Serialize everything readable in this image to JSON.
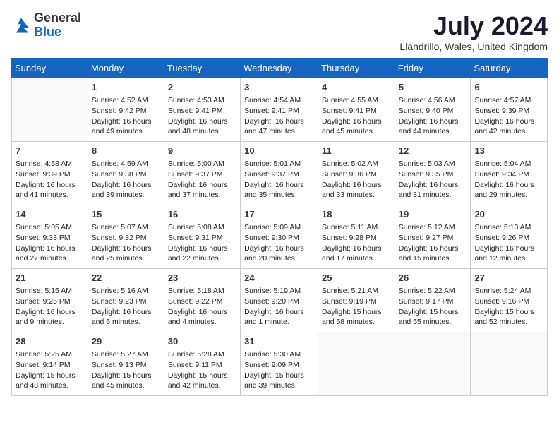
{
  "logo": {
    "general": "General",
    "blue": "Blue"
  },
  "title": "July 2024",
  "subtitle": "Llandrillo, Wales, United Kingdom",
  "days_of_week": [
    "Sunday",
    "Monday",
    "Tuesday",
    "Wednesday",
    "Thursday",
    "Friday",
    "Saturday"
  ],
  "weeks": [
    [
      {
        "day": "",
        "info": ""
      },
      {
        "day": "1",
        "info": "Sunrise: 4:52 AM\nSunset: 9:42 PM\nDaylight: 16 hours\nand 49 minutes."
      },
      {
        "day": "2",
        "info": "Sunrise: 4:53 AM\nSunset: 9:41 PM\nDaylight: 16 hours\nand 48 minutes."
      },
      {
        "day": "3",
        "info": "Sunrise: 4:54 AM\nSunset: 9:41 PM\nDaylight: 16 hours\nand 47 minutes."
      },
      {
        "day": "4",
        "info": "Sunrise: 4:55 AM\nSunset: 9:41 PM\nDaylight: 16 hours\nand 45 minutes."
      },
      {
        "day": "5",
        "info": "Sunrise: 4:56 AM\nSunset: 9:40 PM\nDaylight: 16 hours\nand 44 minutes."
      },
      {
        "day": "6",
        "info": "Sunrise: 4:57 AM\nSunset: 9:39 PM\nDaylight: 16 hours\nand 42 minutes."
      }
    ],
    [
      {
        "day": "7",
        "info": "Sunrise: 4:58 AM\nSunset: 9:39 PM\nDaylight: 16 hours\nand 41 minutes."
      },
      {
        "day": "8",
        "info": "Sunrise: 4:59 AM\nSunset: 9:38 PM\nDaylight: 16 hours\nand 39 minutes."
      },
      {
        "day": "9",
        "info": "Sunrise: 5:00 AM\nSunset: 9:37 PM\nDaylight: 16 hours\nand 37 minutes."
      },
      {
        "day": "10",
        "info": "Sunrise: 5:01 AM\nSunset: 9:37 PM\nDaylight: 16 hours\nand 35 minutes."
      },
      {
        "day": "11",
        "info": "Sunrise: 5:02 AM\nSunset: 9:36 PM\nDaylight: 16 hours\nand 33 minutes."
      },
      {
        "day": "12",
        "info": "Sunrise: 5:03 AM\nSunset: 9:35 PM\nDaylight: 16 hours\nand 31 minutes."
      },
      {
        "day": "13",
        "info": "Sunrise: 5:04 AM\nSunset: 9:34 PM\nDaylight: 16 hours\nand 29 minutes."
      }
    ],
    [
      {
        "day": "14",
        "info": "Sunrise: 5:05 AM\nSunset: 9:33 PM\nDaylight: 16 hours\nand 27 minutes."
      },
      {
        "day": "15",
        "info": "Sunrise: 5:07 AM\nSunset: 9:32 PM\nDaylight: 16 hours\nand 25 minutes."
      },
      {
        "day": "16",
        "info": "Sunrise: 5:08 AM\nSunset: 9:31 PM\nDaylight: 16 hours\nand 22 minutes."
      },
      {
        "day": "17",
        "info": "Sunrise: 5:09 AM\nSunset: 9:30 PM\nDaylight: 16 hours\nand 20 minutes."
      },
      {
        "day": "18",
        "info": "Sunrise: 5:11 AM\nSunset: 9:28 PM\nDaylight: 16 hours\nand 17 minutes."
      },
      {
        "day": "19",
        "info": "Sunrise: 5:12 AM\nSunset: 9:27 PM\nDaylight: 16 hours\nand 15 minutes."
      },
      {
        "day": "20",
        "info": "Sunrise: 5:13 AM\nSunset: 9:26 PM\nDaylight: 16 hours\nand 12 minutes."
      }
    ],
    [
      {
        "day": "21",
        "info": "Sunrise: 5:15 AM\nSunset: 9:25 PM\nDaylight: 16 hours\nand 9 minutes."
      },
      {
        "day": "22",
        "info": "Sunrise: 5:16 AM\nSunset: 9:23 PM\nDaylight: 16 hours\nand 6 minutes."
      },
      {
        "day": "23",
        "info": "Sunrise: 5:18 AM\nSunset: 9:22 PM\nDaylight: 16 hours\nand 4 minutes."
      },
      {
        "day": "24",
        "info": "Sunrise: 5:19 AM\nSunset: 9:20 PM\nDaylight: 16 hours\nand 1 minute."
      },
      {
        "day": "25",
        "info": "Sunrise: 5:21 AM\nSunset: 9:19 PM\nDaylight: 15 hours\nand 58 minutes."
      },
      {
        "day": "26",
        "info": "Sunrise: 5:22 AM\nSunset: 9:17 PM\nDaylight: 15 hours\nand 55 minutes."
      },
      {
        "day": "27",
        "info": "Sunrise: 5:24 AM\nSunset: 9:16 PM\nDaylight: 15 hours\nand 52 minutes."
      }
    ],
    [
      {
        "day": "28",
        "info": "Sunrise: 5:25 AM\nSunset: 9:14 PM\nDaylight: 15 hours\nand 48 minutes."
      },
      {
        "day": "29",
        "info": "Sunrise: 5:27 AM\nSunset: 9:13 PM\nDaylight: 15 hours\nand 45 minutes."
      },
      {
        "day": "30",
        "info": "Sunrise: 5:28 AM\nSunset: 9:11 PM\nDaylight: 15 hours\nand 42 minutes."
      },
      {
        "day": "31",
        "info": "Sunrise: 5:30 AM\nSunset: 9:09 PM\nDaylight: 15 hours\nand 39 minutes."
      },
      {
        "day": "",
        "info": ""
      },
      {
        "day": "",
        "info": ""
      },
      {
        "day": "",
        "info": ""
      }
    ]
  ]
}
